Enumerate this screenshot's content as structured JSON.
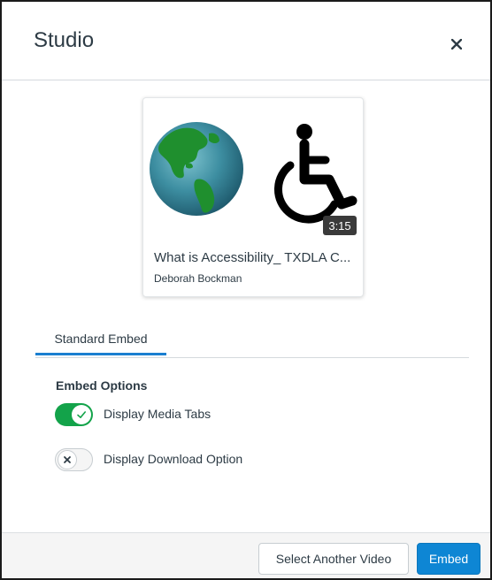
{
  "modal": {
    "title": "Studio",
    "close_label": "×"
  },
  "media": {
    "title": "What is Accessibility_ TXDLA C...",
    "author": "Deborah Bockman",
    "duration": "3:15",
    "thumbnail_icons": [
      "globe-icon",
      "wheelchair-icon"
    ]
  },
  "tabs": [
    {
      "label": "Standard Embed",
      "selected": true
    }
  ],
  "options": {
    "heading": "Embed Options",
    "items": [
      {
        "label": "Display Media Tabs",
        "checked": true
      },
      {
        "label": "Display Download Option",
        "checked": false
      }
    ]
  },
  "footer": {
    "select_another_label": "Select Another Video",
    "embed_label": "Embed"
  },
  "colors": {
    "accent": "#0e86d4",
    "toggle_on": "#13a34a",
    "tab_indicator": "#1a7fd0",
    "text": "#2d3b45"
  }
}
